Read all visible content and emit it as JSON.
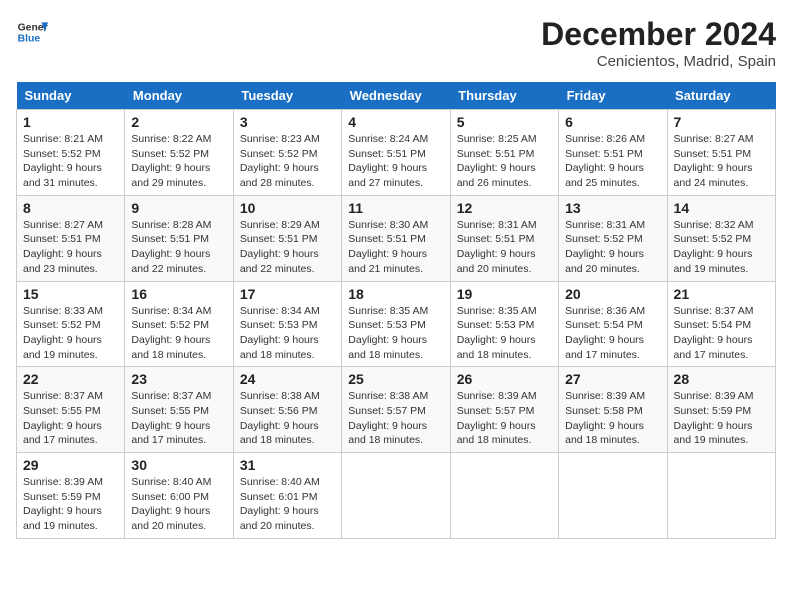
{
  "header": {
    "logo_line1": "General",
    "logo_line2": "Blue",
    "month_title": "December 2024",
    "location": "Cenicientos, Madrid, Spain"
  },
  "days_of_week": [
    "Sunday",
    "Monday",
    "Tuesday",
    "Wednesday",
    "Thursday",
    "Friday",
    "Saturday"
  ],
  "weeks": [
    [
      {
        "day": 1,
        "info": "Sunrise: 8:21 AM\nSunset: 5:52 PM\nDaylight: 9 hours\nand 31 minutes."
      },
      {
        "day": 2,
        "info": "Sunrise: 8:22 AM\nSunset: 5:52 PM\nDaylight: 9 hours\nand 29 minutes."
      },
      {
        "day": 3,
        "info": "Sunrise: 8:23 AM\nSunset: 5:52 PM\nDaylight: 9 hours\nand 28 minutes."
      },
      {
        "day": 4,
        "info": "Sunrise: 8:24 AM\nSunset: 5:51 PM\nDaylight: 9 hours\nand 27 minutes."
      },
      {
        "day": 5,
        "info": "Sunrise: 8:25 AM\nSunset: 5:51 PM\nDaylight: 9 hours\nand 26 minutes."
      },
      {
        "day": 6,
        "info": "Sunrise: 8:26 AM\nSunset: 5:51 PM\nDaylight: 9 hours\nand 25 minutes."
      },
      {
        "day": 7,
        "info": "Sunrise: 8:27 AM\nSunset: 5:51 PM\nDaylight: 9 hours\nand 24 minutes."
      }
    ],
    [
      {
        "day": 8,
        "info": "Sunrise: 8:27 AM\nSunset: 5:51 PM\nDaylight: 9 hours\nand 23 minutes."
      },
      {
        "day": 9,
        "info": "Sunrise: 8:28 AM\nSunset: 5:51 PM\nDaylight: 9 hours\nand 22 minutes."
      },
      {
        "day": 10,
        "info": "Sunrise: 8:29 AM\nSunset: 5:51 PM\nDaylight: 9 hours\nand 22 minutes."
      },
      {
        "day": 11,
        "info": "Sunrise: 8:30 AM\nSunset: 5:51 PM\nDaylight: 9 hours\nand 21 minutes."
      },
      {
        "day": 12,
        "info": "Sunrise: 8:31 AM\nSunset: 5:51 PM\nDaylight: 9 hours\nand 20 minutes."
      },
      {
        "day": 13,
        "info": "Sunrise: 8:31 AM\nSunset: 5:52 PM\nDaylight: 9 hours\nand 20 minutes."
      },
      {
        "day": 14,
        "info": "Sunrise: 8:32 AM\nSunset: 5:52 PM\nDaylight: 9 hours\nand 19 minutes."
      }
    ],
    [
      {
        "day": 15,
        "info": "Sunrise: 8:33 AM\nSunset: 5:52 PM\nDaylight: 9 hours\nand 19 minutes."
      },
      {
        "day": 16,
        "info": "Sunrise: 8:34 AM\nSunset: 5:52 PM\nDaylight: 9 hours\nand 18 minutes."
      },
      {
        "day": 17,
        "info": "Sunrise: 8:34 AM\nSunset: 5:53 PM\nDaylight: 9 hours\nand 18 minutes."
      },
      {
        "day": 18,
        "info": "Sunrise: 8:35 AM\nSunset: 5:53 PM\nDaylight: 9 hours\nand 18 minutes."
      },
      {
        "day": 19,
        "info": "Sunrise: 8:35 AM\nSunset: 5:53 PM\nDaylight: 9 hours\nand 18 minutes."
      },
      {
        "day": 20,
        "info": "Sunrise: 8:36 AM\nSunset: 5:54 PM\nDaylight: 9 hours\nand 17 minutes."
      },
      {
        "day": 21,
        "info": "Sunrise: 8:37 AM\nSunset: 5:54 PM\nDaylight: 9 hours\nand 17 minutes."
      }
    ],
    [
      {
        "day": 22,
        "info": "Sunrise: 8:37 AM\nSunset: 5:55 PM\nDaylight: 9 hours\nand 17 minutes."
      },
      {
        "day": 23,
        "info": "Sunrise: 8:37 AM\nSunset: 5:55 PM\nDaylight: 9 hours\nand 17 minutes."
      },
      {
        "day": 24,
        "info": "Sunrise: 8:38 AM\nSunset: 5:56 PM\nDaylight: 9 hours\nand 18 minutes."
      },
      {
        "day": 25,
        "info": "Sunrise: 8:38 AM\nSunset: 5:57 PM\nDaylight: 9 hours\nand 18 minutes."
      },
      {
        "day": 26,
        "info": "Sunrise: 8:39 AM\nSunset: 5:57 PM\nDaylight: 9 hours\nand 18 minutes."
      },
      {
        "day": 27,
        "info": "Sunrise: 8:39 AM\nSunset: 5:58 PM\nDaylight: 9 hours\nand 18 minutes."
      },
      {
        "day": 28,
        "info": "Sunrise: 8:39 AM\nSunset: 5:59 PM\nDaylight: 9 hours\nand 19 minutes."
      }
    ],
    [
      {
        "day": 29,
        "info": "Sunrise: 8:39 AM\nSunset: 5:59 PM\nDaylight: 9 hours\nand 19 minutes."
      },
      {
        "day": 30,
        "info": "Sunrise: 8:40 AM\nSunset: 6:00 PM\nDaylight: 9 hours\nand 20 minutes."
      },
      {
        "day": 31,
        "info": "Sunrise: 8:40 AM\nSunset: 6:01 PM\nDaylight: 9 hours\nand 20 minutes."
      },
      null,
      null,
      null,
      null
    ]
  ]
}
